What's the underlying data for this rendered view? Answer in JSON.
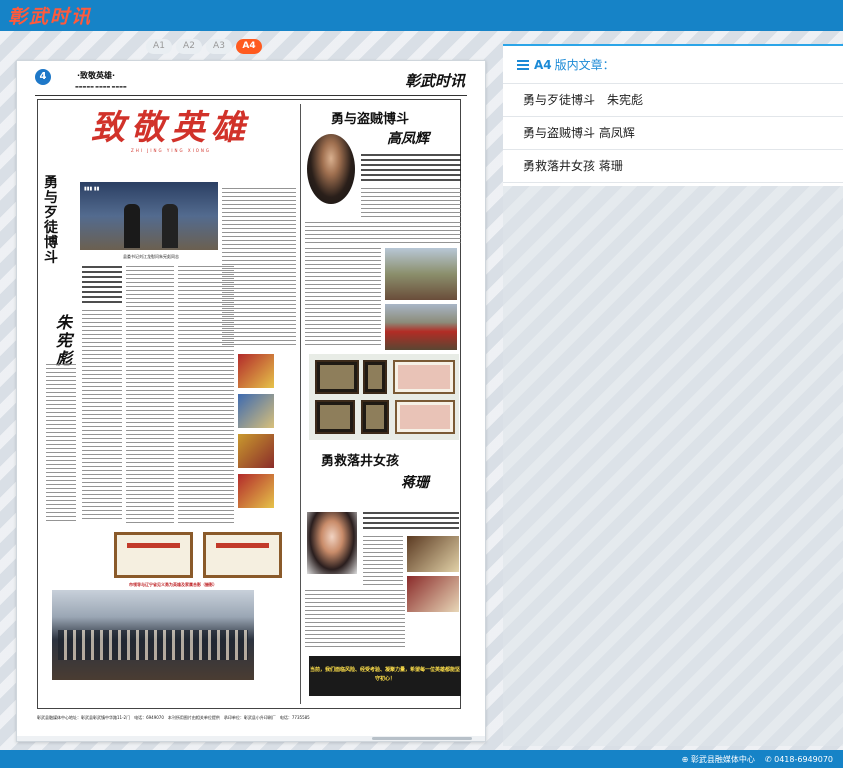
{
  "header": {
    "logo_text": "彰武时讯"
  },
  "page_tabs": [
    {
      "label": "A1",
      "active": false
    },
    {
      "label": "A2",
      "active": false
    },
    {
      "label": "A3",
      "active": false
    },
    {
      "label": "A4",
      "active": true
    }
  ],
  "newspaper": {
    "page_number": "4",
    "section": "·致敬英雄·",
    "logo": "彰武时讯",
    "banner": "致敬英雄",
    "banner_pinyin": "ZHI JING YING XIONG",
    "article1_title": "勇与歹徒博斗",
    "article1_name": "朱宪彪",
    "photo_caption": "县委书记刘江龙慰问朱宪彪同志",
    "article2_title_line1": "勇与盗贼博斗",
    "article2_title_line2": "高凤辉",
    "article3_title_line1": "勇救落井女孩",
    "article3_title_line2": "蒋珊",
    "red_caption": "市领导与辽宁省见义勇为英雄及家属合影（摄影）",
    "black_box": "当前，我们面临风险、经受考验、凝聚力量，希望每一位英雄都能坚守初心！",
    "footer_text": "彰武县融媒体中心地址：彰武县彰武镇中华路11-2门　电话：6949070　本刊所用图片由相关单位提供　承印单位：彰武县小升印刷厂　电话：7735585"
  },
  "side_panel": {
    "page_label": "A4",
    "title": "版内文章：",
    "articles": [
      "勇与歹徒博斗　朱宪彪",
      "勇与盗贼博斗 高凤辉",
      "勇救落井女孩 蒋珊"
    ]
  },
  "footer": {
    "org": "彰武县融媒体中心",
    "phone": "0418-6949070"
  }
}
